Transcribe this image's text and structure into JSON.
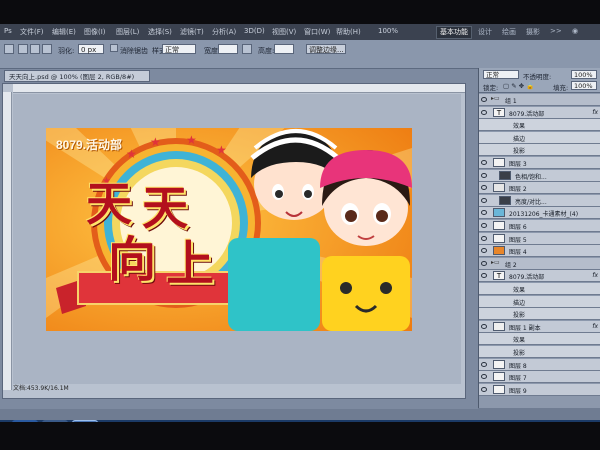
{
  "menu": {
    "items": [
      "文件(F)",
      "编辑(E)",
      "图像(I)",
      "图层(L)",
      "选择(S)",
      "滤镜(T)",
      "分析(A)",
      "3D(D)",
      "视图(V)",
      "窗口(W)",
      "帮助(H)"
    ],
    "zoom_value": "100%",
    "workspace": "基本功能",
    "workspace_links": [
      "设计",
      "绘画",
      "摄影",
      ">>"
    ]
  },
  "options": {
    "feather_label": "羽化:",
    "feather_value": "0 px",
    "antialias_label": "消除锯齿",
    "style_label": "样式:",
    "style_value": "正常",
    "width_label": "宽度:",
    "height_label": "高度:",
    "refine_label": "调整边缘..."
  },
  "document": {
    "tab_title": "天天向上.psd @ 100% (图层 2, RGB/8#)",
    "status": "文档:453.9K/16.1M"
  },
  "artwork": {
    "brand": "8079.活动部",
    "chars": [
      "天",
      "天",
      "向",
      "上"
    ]
  },
  "layers_panel": {
    "blend_mode": "正常",
    "opacity_label": "不透明度:",
    "opacity_value": "100%",
    "lock_label": "锁定:",
    "fill_label": "填充:",
    "fill_value": "100%",
    "rows": [
      {
        "name": "组 1",
        "kind": "group",
        "fx": ""
      },
      {
        "name": "8079.活动部",
        "kind": "text",
        "fx": "fx"
      },
      {
        "name": "效果",
        "kind": "sub",
        "fx": ""
      },
      {
        "name": "描边",
        "kind": "sub",
        "fx": ""
      },
      {
        "name": "投影",
        "kind": "sub",
        "fx": ""
      },
      {
        "name": "图层 3",
        "kind": "layer",
        "fx": ""
      },
      {
        "name": "色相/饱和...",
        "kind": "adjust",
        "fx": ""
      },
      {
        "name": "图层 2",
        "kind": "layer",
        "fx": ""
      },
      {
        "name": "亮度/对比...",
        "kind": "adjust",
        "fx": ""
      },
      {
        "name": "20131206_卡通素材_(4)",
        "kind": "layer",
        "fx": ""
      },
      {
        "name": "图层 6",
        "kind": "layer",
        "fx": ""
      },
      {
        "name": "图层 5",
        "kind": "layer",
        "fx": ""
      },
      {
        "name": "图层 4",
        "kind": "layer",
        "fx": ""
      },
      {
        "name": "组 2",
        "kind": "group",
        "fx": ""
      },
      {
        "name": "8079.活动部",
        "kind": "text",
        "fx": "fx"
      },
      {
        "name": "效果",
        "kind": "sub",
        "fx": ""
      },
      {
        "name": "描边",
        "kind": "sub",
        "fx": ""
      },
      {
        "name": "投影",
        "kind": "sub",
        "fx": ""
      },
      {
        "name": "图层 1 副本",
        "kind": "layer",
        "fx": "fx"
      },
      {
        "name": "效果",
        "kind": "sub",
        "fx": ""
      },
      {
        "name": "投影",
        "kind": "sub",
        "fx": ""
      },
      {
        "name": "图层 8",
        "kind": "layer",
        "fx": ""
      },
      {
        "name": "图层 7",
        "kind": "layer",
        "fx": ""
      },
      {
        "name": "图层 9",
        "kind": "layer",
        "fx": ""
      }
    ]
  },
  "taskbar": {
    "apps": [
      "ie-icon",
      "folder-icon",
      "photoshop-icon"
    ],
    "ps_label": "Ps"
  },
  "colors": {
    "accent_orange": "#f29a1a",
    "ribbon_red": "#e0343a",
    "title_red": "#b3101d",
    "boy_shirt": "#2fc3c8",
    "girl_shirt": "#ffd21f",
    "girl_hat": "#e8347a"
  }
}
